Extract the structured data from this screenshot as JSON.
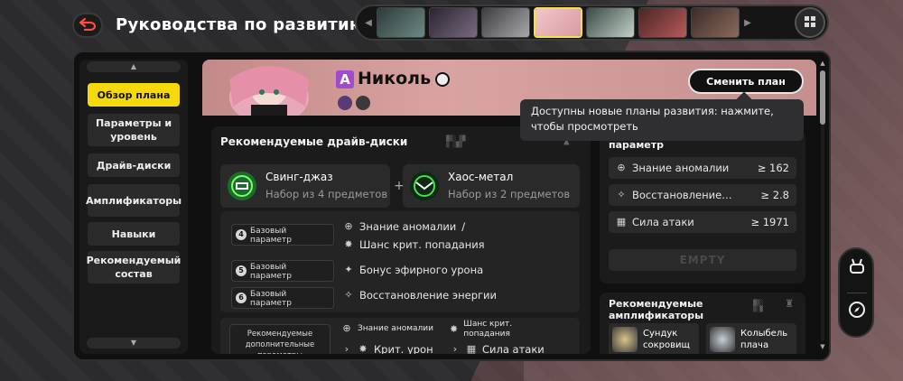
{
  "header": {
    "title": "Руководства по развитию"
  },
  "agents": [
    {
      "name": "agent-1",
      "color": "#2d3a3b"
    },
    {
      "name": "agent-2",
      "color": "#2a2530"
    },
    {
      "name": "agent-3",
      "color": "#3d3d40"
    },
    {
      "name": "agent-4",
      "color": "#d89aa0",
      "active": true
    },
    {
      "name": "agent-5",
      "color": "#3a4a45"
    },
    {
      "name": "agent-6",
      "color": "#4a2525"
    },
    {
      "name": "agent-7",
      "color": "#3a2c2a"
    }
  ],
  "sidebar": {
    "items": [
      {
        "label": "Обзор плана",
        "active": true
      },
      {
        "label": "Параметры и уровень"
      },
      {
        "label": "Драйв-диски"
      },
      {
        "label": "Амплификаторы"
      },
      {
        "label": "Навыки"
      },
      {
        "label": "Рекомендуемый состав"
      }
    ]
  },
  "hero": {
    "rank": "A",
    "name": "Николь",
    "change_plan": "Сменить план"
  },
  "tooltip": {
    "text": "Доступны новые планы развития: нажмите, чтобы просмотреть"
  },
  "drives": {
    "title": "Рекомендуемые драйв-диски",
    "set1": {
      "name": "Свинг-джаз",
      "sub": "Набор из 4 предметов"
    },
    "set2": {
      "name": "Хаос-метал",
      "sub": "Набор из 2 предметов"
    },
    "slots": [
      {
        "num": "4",
        "tag": "Базовый параметр",
        "stats": [
          "Знание аномалии",
          "Шанс крит. попадания"
        ]
      },
      {
        "num": "5",
        "tag": "Базовый параметр",
        "stats": [
          "Бонус эфирного урона"
        ]
      },
      {
        "num": "6",
        "tag": "Базовый параметр",
        "stats": [
          "Восстановление энергии"
        ]
      }
    ],
    "slash": "/",
    "sub_title": "Рекомендуемые дополнительные параметры",
    "sub_stats": [
      "Знание аномалии",
      "Шанс крит. попадания",
      "Крит. урон",
      "Сила атаки"
    ]
  },
  "params": {
    "title": "параметр",
    "rows": [
      {
        "label": "Знание аномалии",
        "value": "≥ 162"
      },
      {
        "label": "Восстановление…",
        "value": "≥ 2.8"
      },
      {
        "label": "Сила атаки",
        "value": "≥ 1971"
      }
    ],
    "empty": "EMPTY"
  },
  "amps": {
    "title": "Рекомендуемые амплификаторы",
    "items": [
      {
        "name": "Сундук сокровищ"
      },
      {
        "name": "Колыбель плача"
      }
    ]
  }
}
